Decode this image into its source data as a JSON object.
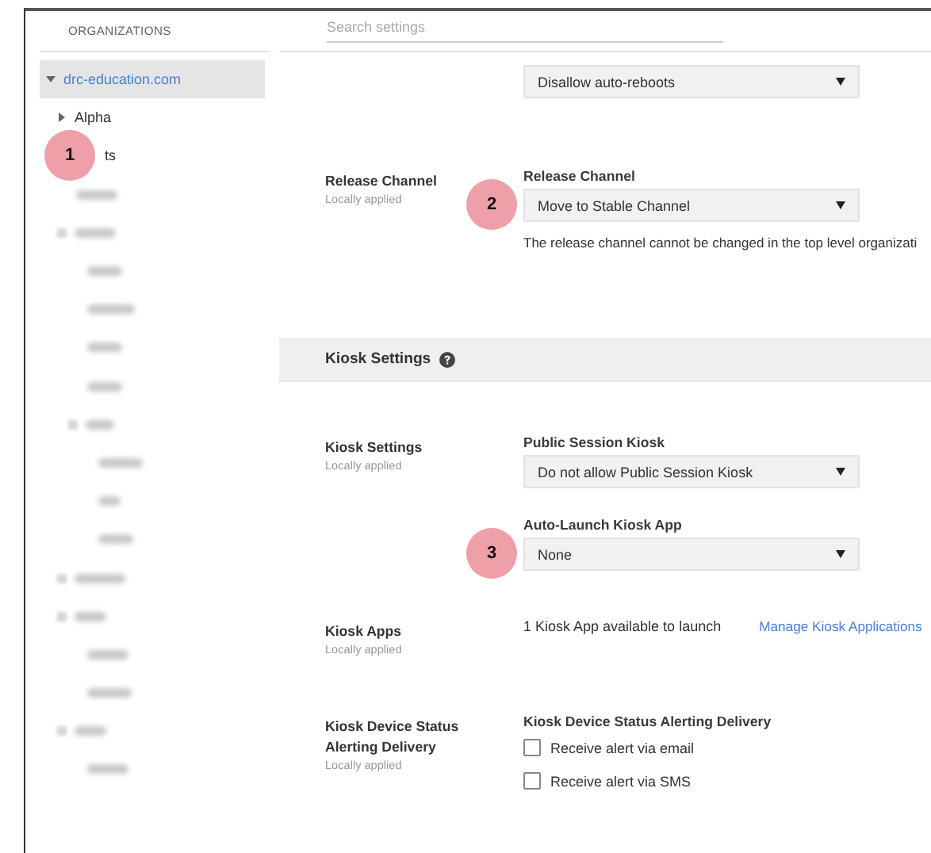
{
  "organizations": {
    "heading": "ORGANIZATIONS",
    "tree": [
      {
        "label": "drc-education.com",
        "selected": true,
        "expanded": true,
        "children": [
          {
            "label": "Alpha",
            "selected": false,
            "expanded": false
          },
          {
            "label": "ts",
            "selected": false,
            "callout": "1"
          },
          {
            "kind": "blurred"
          },
          {
            "kind": "blurred_group",
            "children": [
              {
                "kind": "blurred"
              },
              {
                "kind": "blurred"
              },
              {
                "kind": "blurred"
              },
              {
                "kind": "blurred"
              },
              {
                "kind": "blurred_group",
                "children": [
                  {
                    "kind": "blurred"
                  },
                  {
                    "kind": "blurred"
                  },
                  {
                    "kind": "blurred"
                  }
                ]
              }
            ]
          },
          {
            "kind": "blurred_group"
          },
          {
            "kind": "blurred_group",
            "children": [
              {
                "kind": "blurred"
              },
              {
                "kind": "blurred"
              }
            ]
          },
          {
            "kind": "blurred_group",
            "children": [
              {
                "kind": "blurred"
              }
            ]
          }
        ]
      }
    ]
  },
  "search": {
    "placeholder": "Search settings"
  },
  "settings": [
    {
      "kind": "row",
      "controls": [
        {
          "kind": "select",
          "value": "Disallow auto-reboots"
        }
      ]
    },
    {
      "kind": "row",
      "title": "Release Channel",
      "status": "Locally applied",
      "controls": [
        {
          "kind": "caption",
          "text": "Release Channel"
        },
        {
          "kind": "select",
          "value": "Move to Stable Channel",
          "callout": "2"
        },
        {
          "kind": "note",
          "text": "The release channel cannot be changed in the top level organizati"
        }
      ]
    },
    {
      "kind": "header",
      "title": "Kiosk Settings"
    },
    {
      "kind": "row",
      "title": "Kiosk Settings",
      "status": "Locally applied",
      "controls": [
        {
          "kind": "caption",
          "text": "Public Session Kiosk"
        },
        {
          "kind": "select",
          "value": "Do not allow Public Session Kiosk"
        },
        {
          "kind": "caption",
          "text": "Auto-Launch Kiosk App"
        },
        {
          "kind": "select",
          "value": "None",
          "callout": "3"
        }
      ]
    },
    {
      "kind": "row",
      "title": "Kiosk Apps",
      "status": "Locally applied",
      "controls": [
        {
          "kind": "info",
          "text": "1 Kiosk App available to launch",
          "link": "Manage Kiosk Applications"
        }
      ]
    },
    {
      "kind": "row",
      "title": "Kiosk Device Status Alerting Delivery",
      "status": "Locally applied",
      "controls": [
        {
          "kind": "caption",
          "text": "Kiosk Device Status Alerting Delivery"
        },
        {
          "kind": "checkbox",
          "label": "Receive alert via email",
          "checked": false
        },
        {
          "kind": "checkbox",
          "label": "Receive alert via SMS",
          "checked": false
        }
      ]
    }
  ]
}
